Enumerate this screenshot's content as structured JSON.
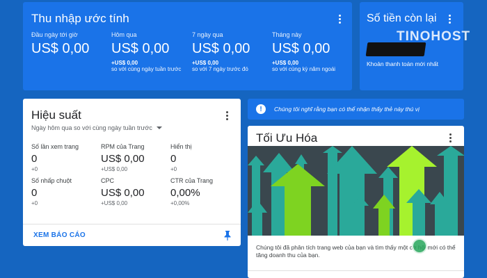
{
  "earnings": {
    "title": "Thu nhập ước tính",
    "metrics": [
      {
        "label": "Đầu ngày tới giờ",
        "value": "US$ 0,00",
        "change": "",
        "compare": ""
      },
      {
        "label": "Hôm qua",
        "value": "US$ 0,00",
        "change": "+US$ 0,00",
        "compare": "so với cùng ngày tuần trước"
      },
      {
        "label": "7 ngày qua",
        "value": "US$ 0,00",
        "change": "+US$ 0,00",
        "compare": "so với 7 ngày trước đó"
      },
      {
        "label": "Tháng này",
        "value": "US$ 0,00",
        "change": "+US$ 0,00",
        "compare": "so với cùng kỳ năm ngoái"
      }
    ]
  },
  "balance": {
    "title": "Số tiền còn lại",
    "note": "Khoản thanh toán mới nhất"
  },
  "watermark": "TINOHOST",
  "performance": {
    "title": "Hiệu suất",
    "range": "Ngày hôm qua so với cùng ngày tuần trước",
    "stats": [
      {
        "label": "Số lần xem trang",
        "value": "0",
        "change": "+0"
      },
      {
        "label": "RPM của Trang",
        "value": "US$ 0,00",
        "change": "+US$ 0,00"
      },
      {
        "label": "Hiển thị",
        "value": "0",
        "change": "+0"
      },
      {
        "label": "Số nhấp chuột",
        "value": "0",
        "change": "+0"
      },
      {
        "label": "CPC",
        "value": "US$ 0,00",
        "change": "+US$ 0,00"
      },
      {
        "label": "CTR của Trang",
        "value": "0,00%",
        "change": "+0,00%"
      }
    ],
    "report_link": "XEM BÁO CÁO"
  },
  "notice": {
    "text": "Chúng tôi nghĩ rằng bạn có thể nhận thấy thẻ này thú vị"
  },
  "optimization": {
    "title": "Tối Ưu Hóa",
    "description": "Chúng tôi đã phân tích trang web của bạn và tìm thấy một cơ hội mới có thể tăng doanh thu của bạn."
  },
  "colors": {
    "background": "#1565c0",
    "card_blue": "#1a73e8",
    "accent_green": "#7ed321",
    "arrow_teal": "#2aa99a"
  }
}
